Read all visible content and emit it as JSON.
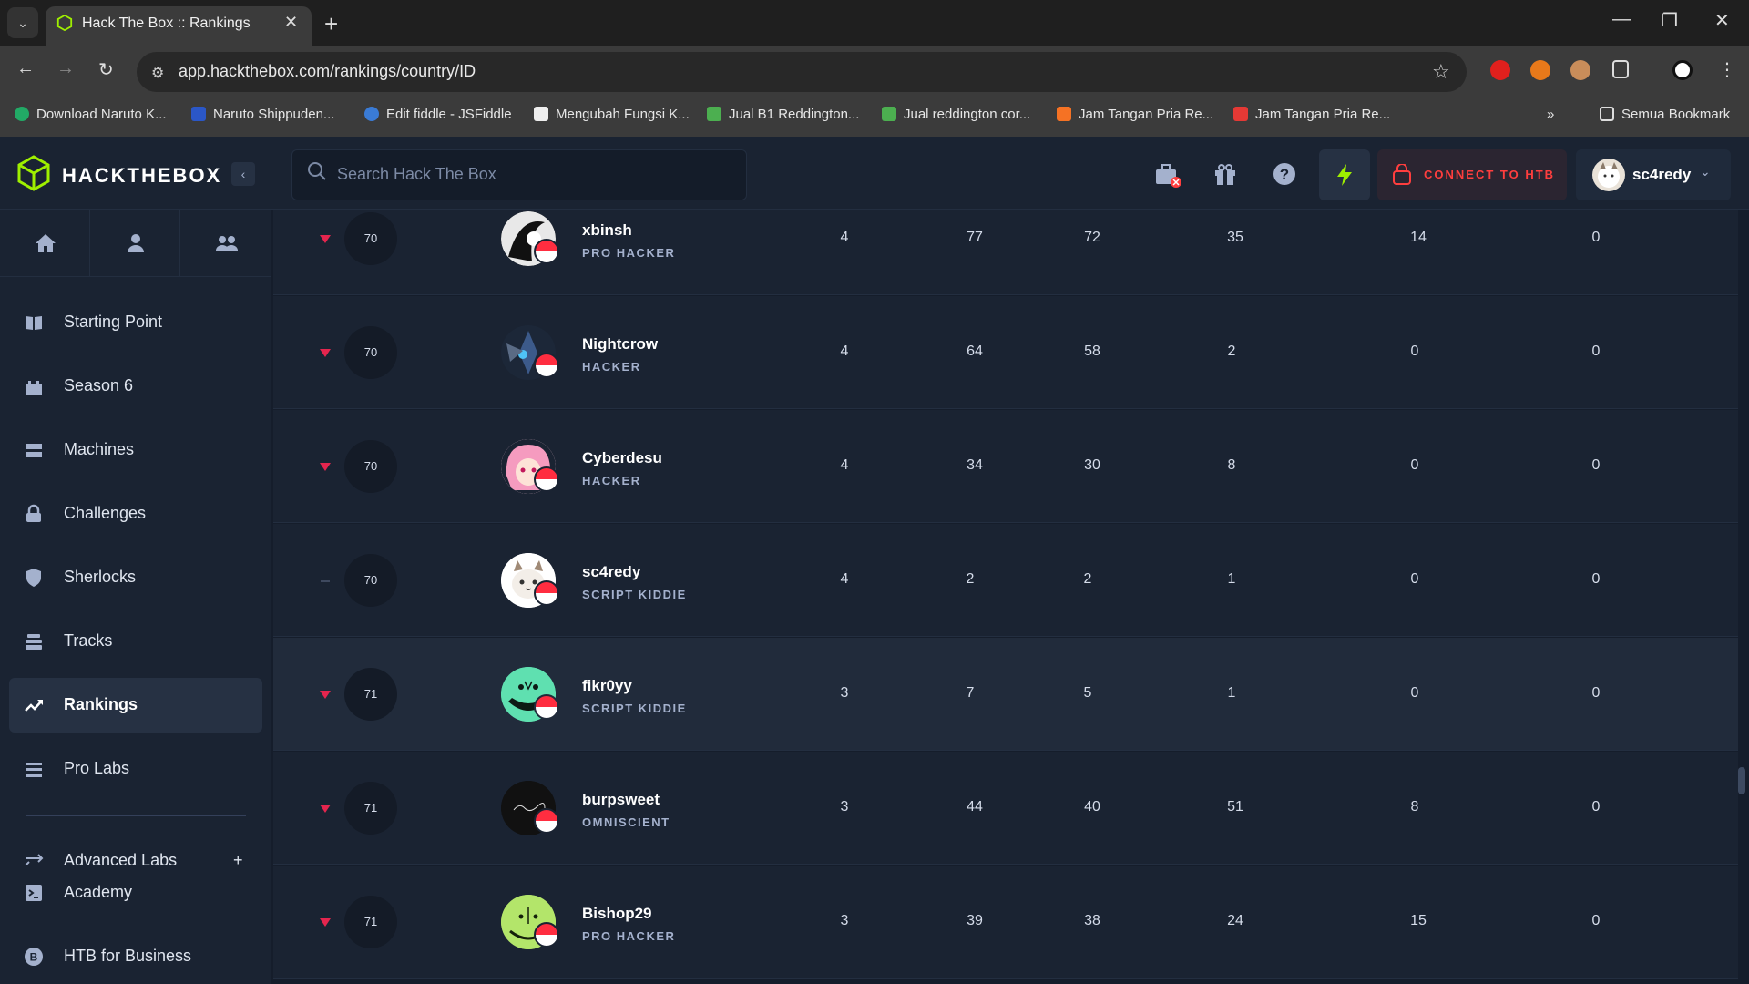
{
  "browser": {
    "tab_title": "Hack The Box :: Rankings",
    "url": "app.hackthebox.com/rankings/country/ID",
    "bookmarks": [
      {
        "label": "Download Naruto K..."
      },
      {
        "label": "Naruto Shippuden..."
      },
      {
        "label": "Edit fiddle - JSFiddle"
      },
      {
        "label": "Mengubah Fungsi K..."
      },
      {
        "label": "Jual B1 Reddington..."
      },
      {
        "label": "Jual reddington cor..."
      },
      {
        "label": "Jam Tangan Pria Re..."
      },
      {
        "label": "Jam Tangan Pria Re..."
      }
    ],
    "all_bookmarks": "Semua Bookmark",
    "overflow": "»"
  },
  "header": {
    "logo": "HACKTHEBOX",
    "search_placeholder": "Search Hack The Box",
    "connect_label": "CONNECT TO HTB",
    "username": "sc4redy",
    "accent": "#9fef00"
  },
  "sidebar": {
    "items": [
      {
        "label": "Starting Point",
        "icon": "book-icon"
      },
      {
        "label": "Season 6",
        "icon": "castle-icon"
      },
      {
        "label": "Machines",
        "icon": "server-icon"
      },
      {
        "label": "Challenges",
        "icon": "lock-icon"
      },
      {
        "label": "Sherlocks",
        "icon": "shield-icon"
      },
      {
        "label": "Tracks",
        "icon": "stack-icon"
      },
      {
        "label": "Rankings",
        "icon": "trend-up-icon",
        "active": true
      },
      {
        "label": "Pro Labs",
        "icon": "grid-icon"
      },
      {
        "label": "Advanced Labs",
        "icon": "arrows-icon"
      },
      {
        "label": "Academy",
        "icon": "terminal-icon"
      },
      {
        "label": "HTB for Business",
        "icon": "business-icon"
      }
    ],
    "advanced_plus": "+"
  },
  "rankings": [
    {
      "trend": "down",
      "rank": "70",
      "name": "xbinsh",
      "title": "PRO HACKER",
      "c1": "4",
      "c2": "77",
      "c3": "72",
      "c4": "35",
      "c5": "14",
      "c6": "0"
    },
    {
      "trend": "down",
      "rank": "70",
      "name": "Nightcrow",
      "title": "HACKER",
      "c1": "4",
      "c2": "64",
      "c3": "58",
      "c4": "2",
      "c5": "0",
      "c6": "0"
    },
    {
      "trend": "down",
      "rank": "70",
      "name": "Cyberdesu",
      "title": "HACKER",
      "c1": "4",
      "c2": "34",
      "c3": "30",
      "c4": "8",
      "c5": "0",
      "c6": "0"
    },
    {
      "trend": "same",
      "rank": "70",
      "name": "sc4redy",
      "title": "SCRIPT KIDDIE",
      "c1": "4",
      "c2": "2",
      "c3": "2",
      "c4": "1",
      "c5": "0",
      "c6": "0"
    },
    {
      "trend": "down",
      "rank": "71",
      "name": "fikr0yy",
      "title": "SCRIPT KIDDIE",
      "c1": "3",
      "c2": "7",
      "c3": "5",
      "c4": "1",
      "c5": "0",
      "c6": "0"
    },
    {
      "trend": "down",
      "rank": "71",
      "name": "burpsweet",
      "title": "OMNISCIENT",
      "c1": "3",
      "c2": "44",
      "c3": "40",
      "c4": "51",
      "c5": "8",
      "c6": "0"
    },
    {
      "trend": "down",
      "rank": "71",
      "name": "Bishop29",
      "title": "PRO HACKER",
      "c1": "3",
      "c2": "39",
      "c3": "38",
      "c4": "24",
      "c5": "15",
      "c6": "0"
    }
  ],
  "colors": {
    "trend_down": "#e5254e",
    "trend_same": "#4a566e",
    "connect": "#ff3e3e"
  }
}
